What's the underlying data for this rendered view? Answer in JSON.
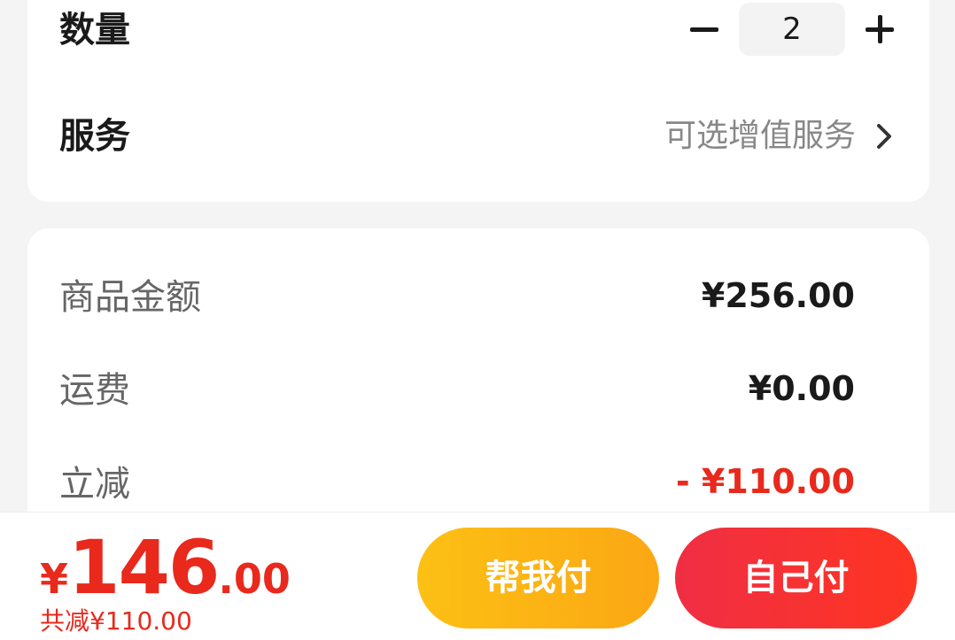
{
  "order": {
    "quantity_label": "数量",
    "quantity_value": "2",
    "service_label": "服务",
    "service_value": "可选增值服务"
  },
  "price_detail": {
    "goods_amount_label": "商品金额",
    "goods_amount_value": "¥256.00",
    "shipping_label": "运费",
    "shipping_value": "¥0.00",
    "discount_label": "立减",
    "discount_value": "- ¥110.00"
  },
  "bottom_bar": {
    "total_currency": "¥",
    "total_integer": "146",
    "total_decimal": ".00",
    "savings_text": "共减¥110.00",
    "help_pay_label": "帮我付",
    "self_pay_label": "自己付"
  },
  "colors": {
    "accent_red": "#e8291c",
    "help_button": "#fcb314",
    "self_button": "#f5303a"
  },
  "icons": {
    "minus": "minus-icon",
    "plus": "plus-icon",
    "chevron": "chevron-right-icon"
  }
}
